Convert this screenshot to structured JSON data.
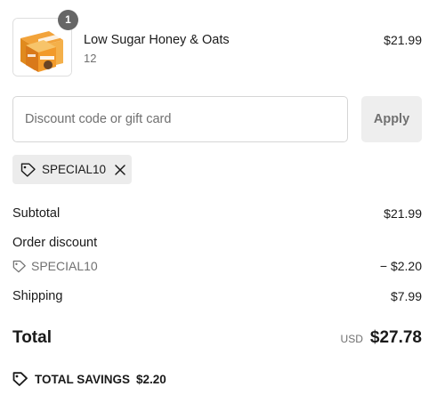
{
  "line_item": {
    "quantity_badge": "1",
    "name": "Low Sugar Honey & Oats",
    "variant": "12",
    "price": "$21.99",
    "image_icon": "product-box-image"
  },
  "discount": {
    "placeholder": "Discount code or gift card",
    "value": "",
    "apply_label": "Apply",
    "applied_code": "SPECIAL10",
    "tag_icon": "tag-icon",
    "remove_icon": "close-icon"
  },
  "summary": {
    "subtotal_label": "Subtotal",
    "subtotal_value": "$21.99",
    "order_discount_label": "Order discount",
    "discount_code": "SPECIAL10",
    "discount_value": "− $2.20",
    "shipping_label": "Shipping",
    "shipping_value": "$7.99",
    "total_label": "Total",
    "currency": "USD",
    "total_value": "$27.78",
    "savings_label": "TOTAL SAVINGS",
    "savings_value": "$2.20"
  },
  "colors": {
    "text": "#1a1a1a",
    "muted": "#707070",
    "badge": "#666666",
    "chip_bg": "#ececec",
    "button_bg": "#eeeeee",
    "border": "#d6d6d6"
  }
}
